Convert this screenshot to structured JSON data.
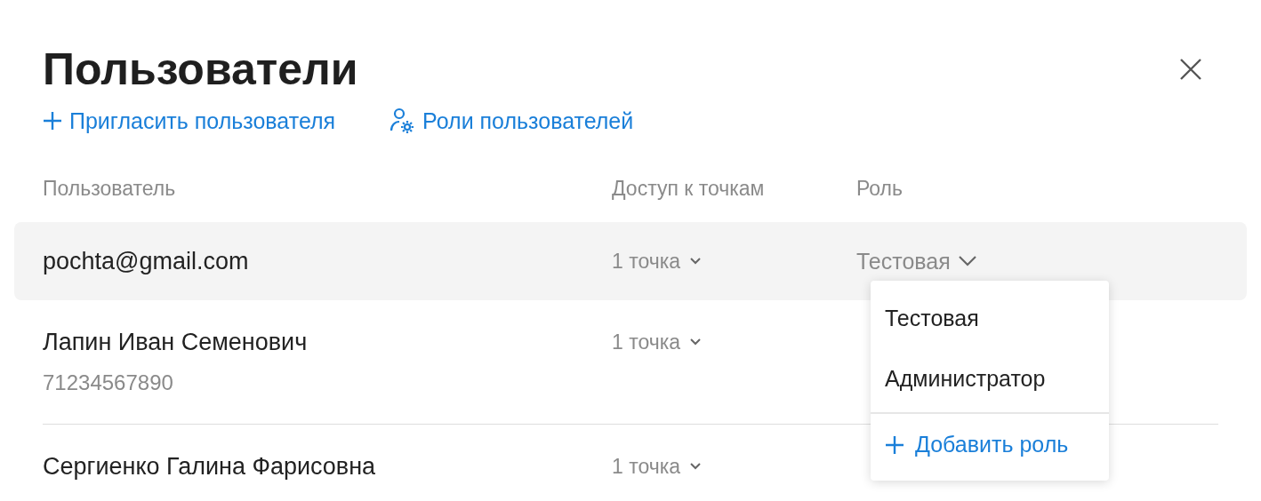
{
  "title": "Пользователи",
  "actions": [
    {
      "kind": "invite",
      "label": "Пригласить пользователя"
    },
    {
      "kind": "roles",
      "label": "Роли пользователей"
    }
  ],
  "columns": [
    "Пользователь",
    "Доступ к точкам",
    "Роль"
  ],
  "rows": [
    {
      "selected": true,
      "name": "pochta@gmail.com",
      "access": "1 точка",
      "role": "Тестовая",
      "role_menu": {
        "items": [
          "Тестовая",
          "Администратор"
        ],
        "add_label": "Добавить роль"
      }
    },
    {
      "selected": false,
      "name": "Лапин Иван Семенович",
      "phone": "71234567890",
      "access": "1 точка"
    },
    {
      "selected": false,
      "name": "Сергиенко Галина Фарисовна",
      "access": "1 точка"
    }
  ]
}
